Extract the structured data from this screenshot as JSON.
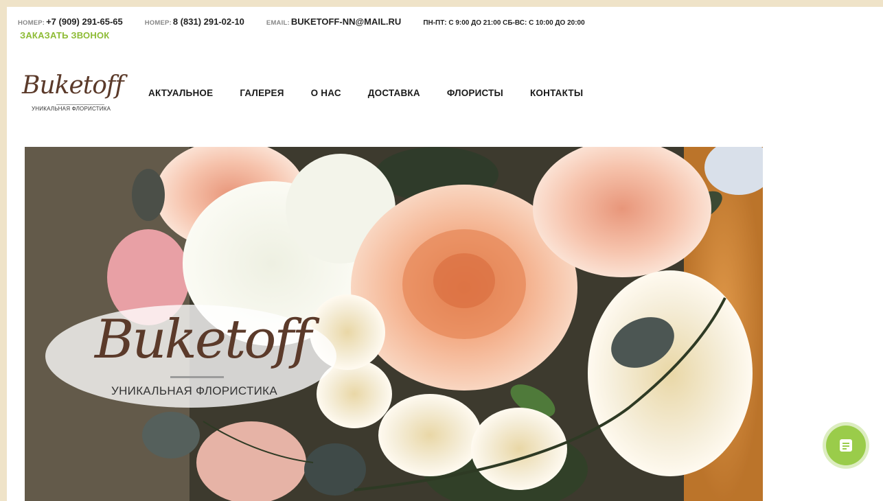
{
  "topbar": {
    "phone1_label": "НОМЕР:",
    "phone1": "+7 (909) 291-65-65",
    "phone2_label": "НОМЕР:",
    "phone2": "8 (831) 291-02-10",
    "email_label": "EMAIL:",
    "email": "BUKETOFF-NN@MAIL.RU",
    "hours": "ПН-ПТ: С 9:00 ДО 21:00 СБ-ВС: С 10:00 ДО 20:00",
    "callback": "ЗАКАЗАТЬ ЗВОНОК"
  },
  "logo": {
    "name": "Buketoff",
    "tagline": "УНИКАЛЬНАЯ ФЛОРИСТИКА"
  },
  "nav": {
    "items": [
      {
        "label": "АКТУАЛЬНОЕ"
      },
      {
        "label": "ГАЛЕРЕЯ"
      },
      {
        "label": "О НАС"
      },
      {
        "label": "ДОСТАВКА"
      },
      {
        "label": "ФЛОРИСТЫ"
      },
      {
        "label": "КОНТАКТЫ"
      }
    ]
  },
  "hero": {
    "logo_name": "Buketoff",
    "logo_tagline": "УНИКАЛЬНАЯ ФЛОРИСТИКА"
  },
  "chat": {
    "icon": "chat-form-icon"
  },
  "colors": {
    "accent": "#8dbb34",
    "brand": "#5b3a2a",
    "chat": "#9acc4a"
  }
}
